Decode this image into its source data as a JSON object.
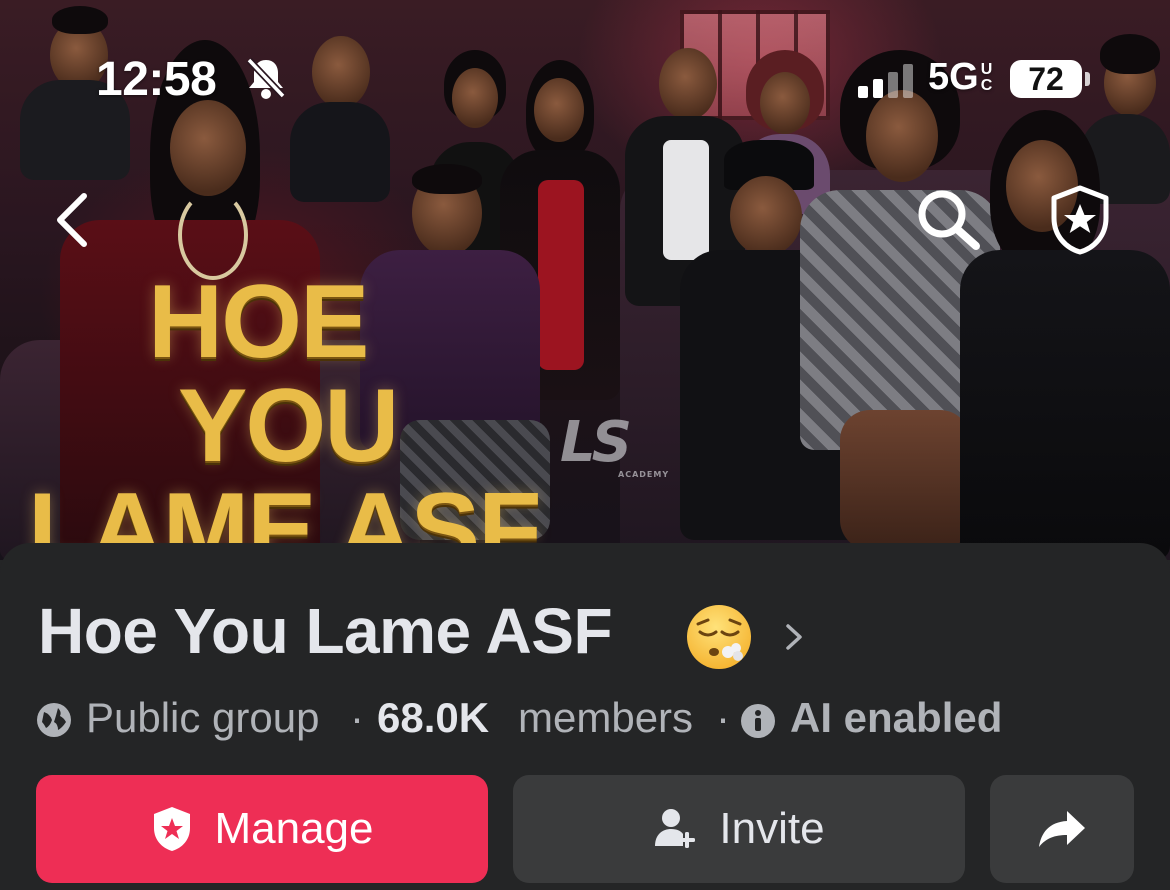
{
  "status_bar": {
    "time": "12:58",
    "network": "5G",
    "network_suffix": "UC",
    "battery": "72"
  },
  "cover": {
    "title_lines": [
      "HOE",
      "YOU",
      "LAME ASF"
    ],
    "watermark": "LS",
    "watermark_sub": "ACADEMY"
  },
  "nav": {
    "back_icon": "chevron-left-icon",
    "search_icon": "search-icon",
    "admin_icon": "shield-star-icon"
  },
  "group": {
    "name": "Hoe You Lame ASF",
    "emoji": "face-exhaling",
    "privacy": "Public group",
    "separator": "·",
    "member_count": "68.0K",
    "members_label": "members",
    "ai_label": "AI enabled"
  },
  "actions": {
    "manage_label": "Manage",
    "invite_label": "Invite",
    "share_icon": "share-arrow-icon",
    "manage_color": "#ee2e55",
    "secondary_color": "#3a3b3c"
  }
}
